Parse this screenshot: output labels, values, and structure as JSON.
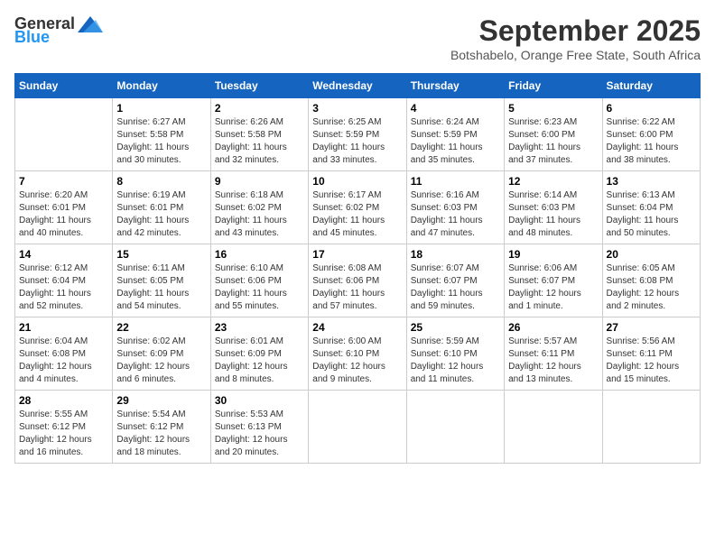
{
  "logo": {
    "text_general": "General",
    "text_blue": "Blue"
  },
  "title": "September 2025",
  "subtitle": "Botshabelo, Orange Free State, South Africa",
  "days_header": [
    "Sunday",
    "Monday",
    "Tuesday",
    "Wednesday",
    "Thursday",
    "Friday",
    "Saturday"
  ],
  "weeks": [
    [
      {
        "day": "",
        "info": ""
      },
      {
        "day": "1",
        "info": "Sunrise: 6:27 AM\nSunset: 5:58 PM\nDaylight: 11 hours\nand 30 minutes."
      },
      {
        "day": "2",
        "info": "Sunrise: 6:26 AM\nSunset: 5:58 PM\nDaylight: 11 hours\nand 32 minutes."
      },
      {
        "day": "3",
        "info": "Sunrise: 6:25 AM\nSunset: 5:59 PM\nDaylight: 11 hours\nand 33 minutes."
      },
      {
        "day": "4",
        "info": "Sunrise: 6:24 AM\nSunset: 5:59 PM\nDaylight: 11 hours\nand 35 minutes."
      },
      {
        "day": "5",
        "info": "Sunrise: 6:23 AM\nSunset: 6:00 PM\nDaylight: 11 hours\nand 37 minutes."
      },
      {
        "day": "6",
        "info": "Sunrise: 6:22 AM\nSunset: 6:00 PM\nDaylight: 11 hours\nand 38 minutes."
      }
    ],
    [
      {
        "day": "7",
        "info": "Sunrise: 6:20 AM\nSunset: 6:01 PM\nDaylight: 11 hours\nand 40 minutes."
      },
      {
        "day": "8",
        "info": "Sunrise: 6:19 AM\nSunset: 6:01 PM\nDaylight: 11 hours\nand 42 minutes."
      },
      {
        "day": "9",
        "info": "Sunrise: 6:18 AM\nSunset: 6:02 PM\nDaylight: 11 hours\nand 43 minutes."
      },
      {
        "day": "10",
        "info": "Sunrise: 6:17 AM\nSunset: 6:02 PM\nDaylight: 11 hours\nand 45 minutes."
      },
      {
        "day": "11",
        "info": "Sunrise: 6:16 AM\nSunset: 6:03 PM\nDaylight: 11 hours\nand 47 minutes."
      },
      {
        "day": "12",
        "info": "Sunrise: 6:14 AM\nSunset: 6:03 PM\nDaylight: 11 hours\nand 48 minutes."
      },
      {
        "day": "13",
        "info": "Sunrise: 6:13 AM\nSunset: 6:04 PM\nDaylight: 11 hours\nand 50 minutes."
      }
    ],
    [
      {
        "day": "14",
        "info": "Sunrise: 6:12 AM\nSunset: 6:04 PM\nDaylight: 11 hours\nand 52 minutes."
      },
      {
        "day": "15",
        "info": "Sunrise: 6:11 AM\nSunset: 6:05 PM\nDaylight: 11 hours\nand 54 minutes."
      },
      {
        "day": "16",
        "info": "Sunrise: 6:10 AM\nSunset: 6:06 PM\nDaylight: 11 hours\nand 55 minutes."
      },
      {
        "day": "17",
        "info": "Sunrise: 6:08 AM\nSunset: 6:06 PM\nDaylight: 11 hours\nand 57 minutes."
      },
      {
        "day": "18",
        "info": "Sunrise: 6:07 AM\nSunset: 6:07 PM\nDaylight: 11 hours\nand 59 minutes."
      },
      {
        "day": "19",
        "info": "Sunrise: 6:06 AM\nSunset: 6:07 PM\nDaylight: 12 hours\nand 1 minute."
      },
      {
        "day": "20",
        "info": "Sunrise: 6:05 AM\nSunset: 6:08 PM\nDaylight: 12 hours\nand 2 minutes."
      }
    ],
    [
      {
        "day": "21",
        "info": "Sunrise: 6:04 AM\nSunset: 6:08 PM\nDaylight: 12 hours\nand 4 minutes."
      },
      {
        "day": "22",
        "info": "Sunrise: 6:02 AM\nSunset: 6:09 PM\nDaylight: 12 hours\nand 6 minutes."
      },
      {
        "day": "23",
        "info": "Sunrise: 6:01 AM\nSunset: 6:09 PM\nDaylight: 12 hours\nand 8 minutes."
      },
      {
        "day": "24",
        "info": "Sunrise: 6:00 AM\nSunset: 6:10 PM\nDaylight: 12 hours\nand 9 minutes."
      },
      {
        "day": "25",
        "info": "Sunrise: 5:59 AM\nSunset: 6:10 PM\nDaylight: 12 hours\nand 11 minutes."
      },
      {
        "day": "26",
        "info": "Sunrise: 5:57 AM\nSunset: 6:11 PM\nDaylight: 12 hours\nand 13 minutes."
      },
      {
        "day": "27",
        "info": "Sunrise: 5:56 AM\nSunset: 6:11 PM\nDaylight: 12 hours\nand 15 minutes."
      }
    ],
    [
      {
        "day": "28",
        "info": "Sunrise: 5:55 AM\nSunset: 6:12 PM\nDaylight: 12 hours\nand 16 minutes."
      },
      {
        "day": "29",
        "info": "Sunrise: 5:54 AM\nSunset: 6:12 PM\nDaylight: 12 hours\nand 18 minutes."
      },
      {
        "day": "30",
        "info": "Sunrise: 5:53 AM\nSunset: 6:13 PM\nDaylight: 12 hours\nand 20 minutes."
      },
      {
        "day": "",
        "info": ""
      },
      {
        "day": "",
        "info": ""
      },
      {
        "day": "",
        "info": ""
      },
      {
        "day": "",
        "info": ""
      }
    ]
  ]
}
